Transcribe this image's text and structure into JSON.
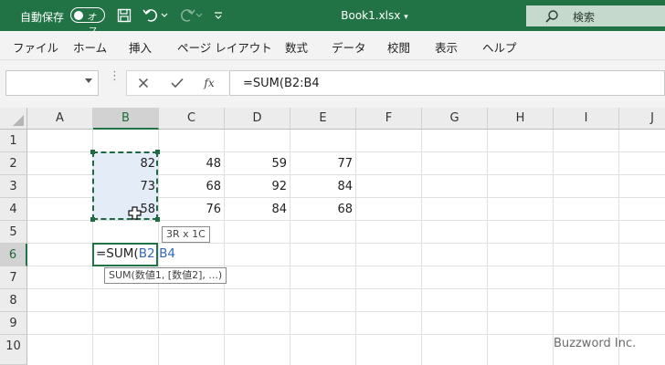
{
  "titlebar": {
    "autosave_label": "自動保存",
    "autosave_toggle": "オフ",
    "document_title": "Book1.xlsx",
    "search_label": "検索",
    "bg_color": "#217346"
  },
  "ribbon": {
    "tabs": [
      "ファイル",
      "ホーム",
      "挿入",
      "ページ レイアウト",
      "数式",
      "データ",
      "校閲",
      "表示",
      "ヘルプ"
    ]
  },
  "formula_bar": {
    "name_box_value": "",
    "cancel_icon": "close-icon",
    "enter_icon": "check-icon",
    "function_label": "fx",
    "formula": "=SUM(B2:B4"
  },
  "sheet": {
    "columns": [
      "A",
      "B",
      "C",
      "D",
      "E",
      "F",
      "G",
      "H",
      "I",
      "J"
    ],
    "rows": [
      "1",
      "2",
      "3",
      "4",
      "5",
      "6",
      "7",
      "8",
      "9",
      "10"
    ],
    "selected_column": "B",
    "selected_row": "6",
    "cells": {
      "B2": "82",
      "C2": "48",
      "D2": "59",
      "E2": "77",
      "B3": "73",
      "C3": "68",
      "D3": "92",
      "E3": "84",
      "B4": "58",
      "C4": "76",
      "D4": "84",
      "E4": "68"
    },
    "range_size_tip": "3R x 1C",
    "editing": {
      "prefix": "=SUM(",
      "reference": "B2:B4"
    },
    "function_tooltip": "SUM(数値1, [数値2], ...)",
    "accent_color": "#217346",
    "range_fill_color": "#e4ecf7"
  },
  "watermark": "Buzzword Inc."
}
